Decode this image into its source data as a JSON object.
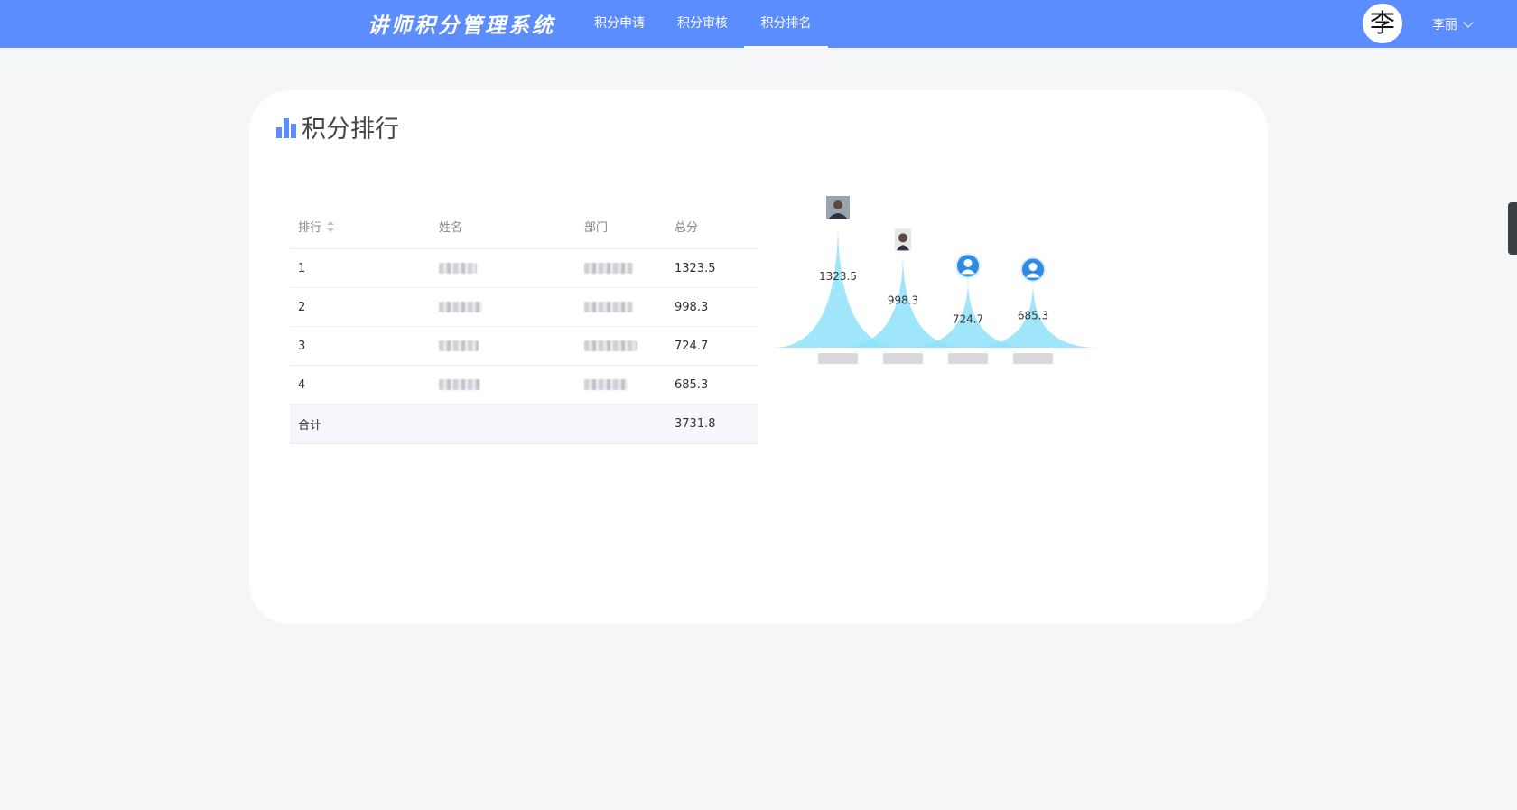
{
  "header": {
    "brand": "讲师积分管理系统",
    "nav": [
      {
        "label": "积分申请",
        "active": false
      },
      {
        "label": "积分审核",
        "active": false
      },
      {
        "label": "积分排名",
        "active": true
      }
    ],
    "avatar_char": "李",
    "user_name": "李丽",
    "bg_color": "#5c8dff"
  },
  "card": {
    "title": "积分排行",
    "title_icon": "bar-chart-icon"
  },
  "table": {
    "columns": [
      "排行",
      "姓名",
      "部门",
      "总分"
    ],
    "rows": [
      {
        "rank": "1",
        "score": "1323.5"
      },
      {
        "rank": "2",
        "score": "998.3"
      },
      {
        "rank": "3",
        "score": "724.7"
      },
      {
        "rank": "4",
        "score": "685.3"
      }
    ],
    "total_label": "合计",
    "total_score": "3731.8"
  },
  "chart_data": {
    "type": "bar",
    "categories": [
      "",
      "",
      "",
      ""
    ],
    "values": [
      1323.5,
      998.3,
      724.7,
      685.3
    ],
    "data_labels": [
      "1323.5",
      "998.3",
      "724.7",
      "685.3"
    ],
    "ylim": [
      0,
      1323.5
    ],
    "series_color": "#8ee2fa",
    "markers": [
      "photo",
      "photo",
      "user-icon",
      "user-icon"
    ]
  }
}
